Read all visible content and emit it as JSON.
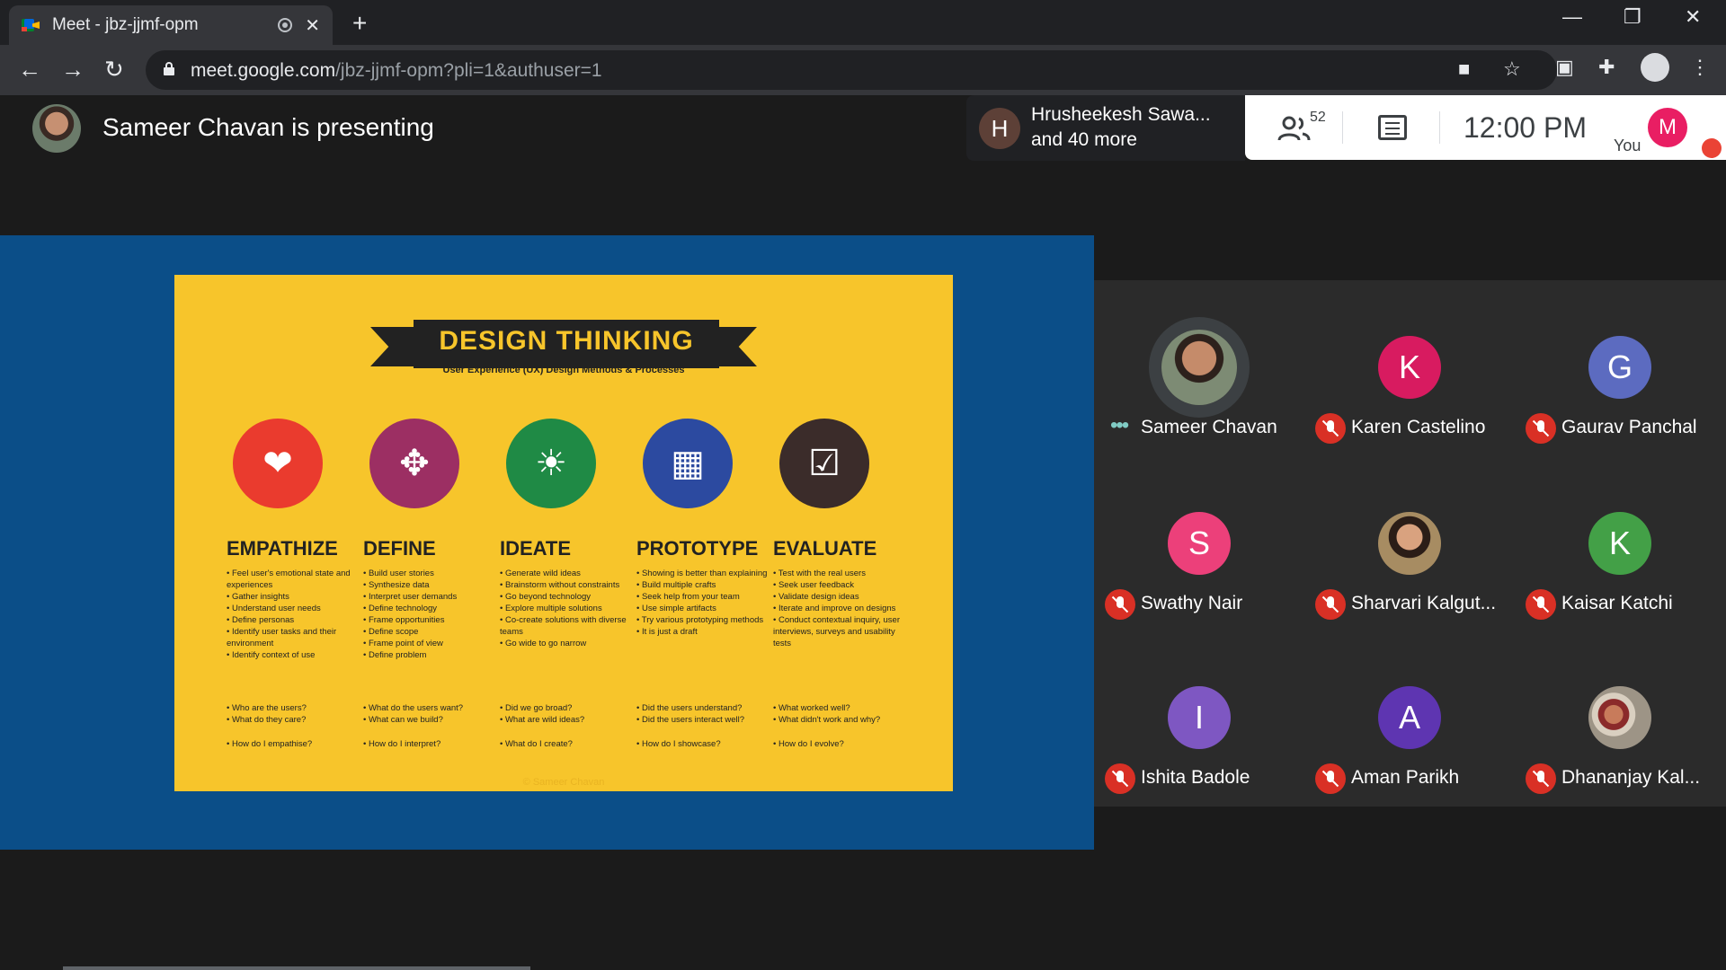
{
  "browser": {
    "tab_title": "Meet - jbz-jjmf-opm",
    "url_host": "meet.google.com",
    "url_path": "/jbz-jjmf-opm?pli=1&authuser=1"
  },
  "meet": {
    "presenting_text": "Sameer Chavan is presenting",
    "others_name": "Hrusheekesh Sawa...",
    "others_more": "and 40 more",
    "people_count": "52",
    "time": "12:00  PM",
    "you_label": "You",
    "self_initial": "M"
  },
  "slide": {
    "title": "DESIGN THINKING",
    "subtitle": "User Experience (UX) Design Methods & Processes",
    "copyright": "© Sameer Chavan",
    "columns": [
      {
        "title": "EMPATHIZE",
        "color": "#ea3b2e",
        "items": [
          "Feel user's emotional state and experiences",
          "Gather insights",
          "Understand user needs",
          "Define personas",
          "Identify user tasks and their environment",
          "Identify context of use"
        ],
        "questions": [
          "Who are the users?",
          "What do they care?"
        ],
        "final": "How do I empathise?"
      },
      {
        "title": "DEFINE",
        "color": "#9c2f63",
        "items": [
          "Build user stories",
          "Synthesize data",
          "Interpret user demands",
          "Define technology",
          "Frame opportunities",
          "Define scope",
          "Frame point of view",
          "Define problem"
        ],
        "questions": [
          "What do the users want?",
          "What can we build?"
        ],
        "final": "How do I interpret?"
      },
      {
        "title": "IDEATE",
        "color": "#1f8a45",
        "items": [
          "Generate wild ideas",
          "Brainstorm without constraints",
          "Go beyond technology",
          "Explore multiple solutions",
          "Co-create solutions with diverse teams",
          "Go wide to go narrow"
        ],
        "questions": [
          "Did we go broad?",
          "What are wild ideas?"
        ],
        "final": "What do I create?"
      },
      {
        "title": "PROTOTYPE",
        "color": "#2c4aa0",
        "items": [
          "Showing is better than explaining",
          "Build multiple crafts",
          "Seek help from your team",
          "Use simple artifacts",
          "Try various prototyping methods",
          "It is just a draft"
        ],
        "questions": [
          "Did the users understand?",
          "Did the users interact well?"
        ],
        "final": "How do I showcase?"
      },
      {
        "title": "EVALUATE",
        "color": "#3b2c2a",
        "items": [
          "Test with the real users",
          "Seek user feedback",
          "Validate design ideas",
          "Iterate and improve on designs",
          "Conduct contextual inquiry, user interviews, surveys and usability tests"
        ],
        "questions": [
          "What worked well?",
          "What didn't work and why?"
        ],
        "final": "How do I evolve?"
      }
    ]
  },
  "participants": [
    {
      "name": "Sameer Chavan",
      "initial": "",
      "color": "",
      "status": "speaking"
    },
    {
      "name": "Karen Castelino",
      "initial": "K",
      "color": "#d81b60",
      "status": "muted"
    },
    {
      "name": "Gaurav Panchal",
      "initial": "G",
      "color": "#5c6bc0",
      "status": "muted"
    },
    {
      "name": "Swathy Nair",
      "initial": "S",
      "color": "#ec407a",
      "status": "muted"
    },
    {
      "name": "Sharvari Kalgut...",
      "initial": "",
      "color": "",
      "status": "muted"
    },
    {
      "name": "Kaisar Katchi",
      "initial": "K",
      "color": "#43a047",
      "status": "muted"
    },
    {
      "name": "Ishita Badole",
      "initial": "I",
      "color": "#7e57c2",
      "status": "muted"
    },
    {
      "name": "Aman Parikh",
      "initial": "A",
      "color": "#5e35b1",
      "status": "muted"
    },
    {
      "name": "Dhananjay Kal...",
      "initial": "",
      "color": "",
      "status": "muted"
    }
  ]
}
